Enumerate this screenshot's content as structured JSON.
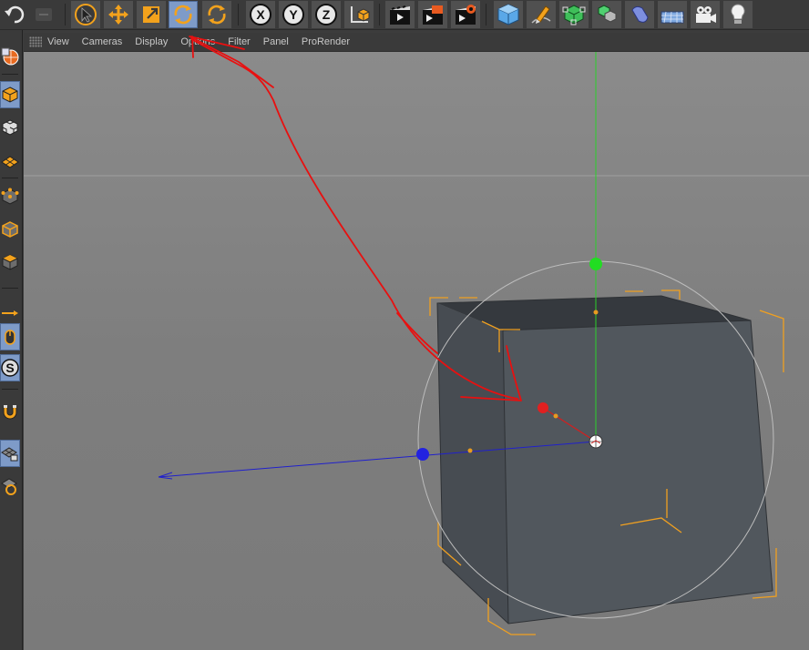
{
  "viewport_menu": {
    "items": [
      "View",
      "Cameras",
      "Display",
      "Options",
      "Filter",
      "Panel",
      "ProRender"
    ]
  },
  "toolbar": {
    "tools": [
      "undo-icon",
      "redo-icon",
      "live-selection-icon",
      "move-icon",
      "scale-icon",
      "rotate-icon",
      "recent-tool-icon",
      "lock-x-icon",
      "lock-y-icon",
      "lock-z-icon",
      "coordinate-system-icon",
      "render-view-icon",
      "render-to-picture-viewer-icon",
      "render-settings-icon",
      "cube-object-icon",
      "pen-spline-icon",
      "subdivision-surface-icon",
      "array-icon",
      "deformer-icon",
      "floor-icon",
      "camera-icon",
      "light-icon"
    ],
    "axis_lock": {
      "x": "X",
      "y": "Y",
      "z": "Z"
    },
    "active_tool": "rotate-icon"
  },
  "left_palette": {
    "tools": [
      "make-editable-icon",
      "model-mode-icon",
      "texture-mode-icon",
      "workplane-mode-icon",
      "points-mode-icon",
      "edges-mode-icon",
      "polygons-mode-icon",
      "enable-axis-icon",
      "tweak-mode-icon",
      "solo-icon",
      "snapping-icon",
      "workplane-lock-icon",
      "quantize-icon"
    ],
    "solo_label": "S"
  },
  "colors": {
    "viewport_bg": "#868686",
    "cube_face_front": "#4f555b",
    "cube_face_side": "#454a50",
    "cube_face_top": "#34383d",
    "bbox_corner": "#f0a020",
    "axis_x": "#e02020",
    "axis_y": "#22dd22",
    "axis_z": "#2222e0",
    "annotation": "#e81010",
    "active_tool_bg": "#7e9bc8"
  }
}
